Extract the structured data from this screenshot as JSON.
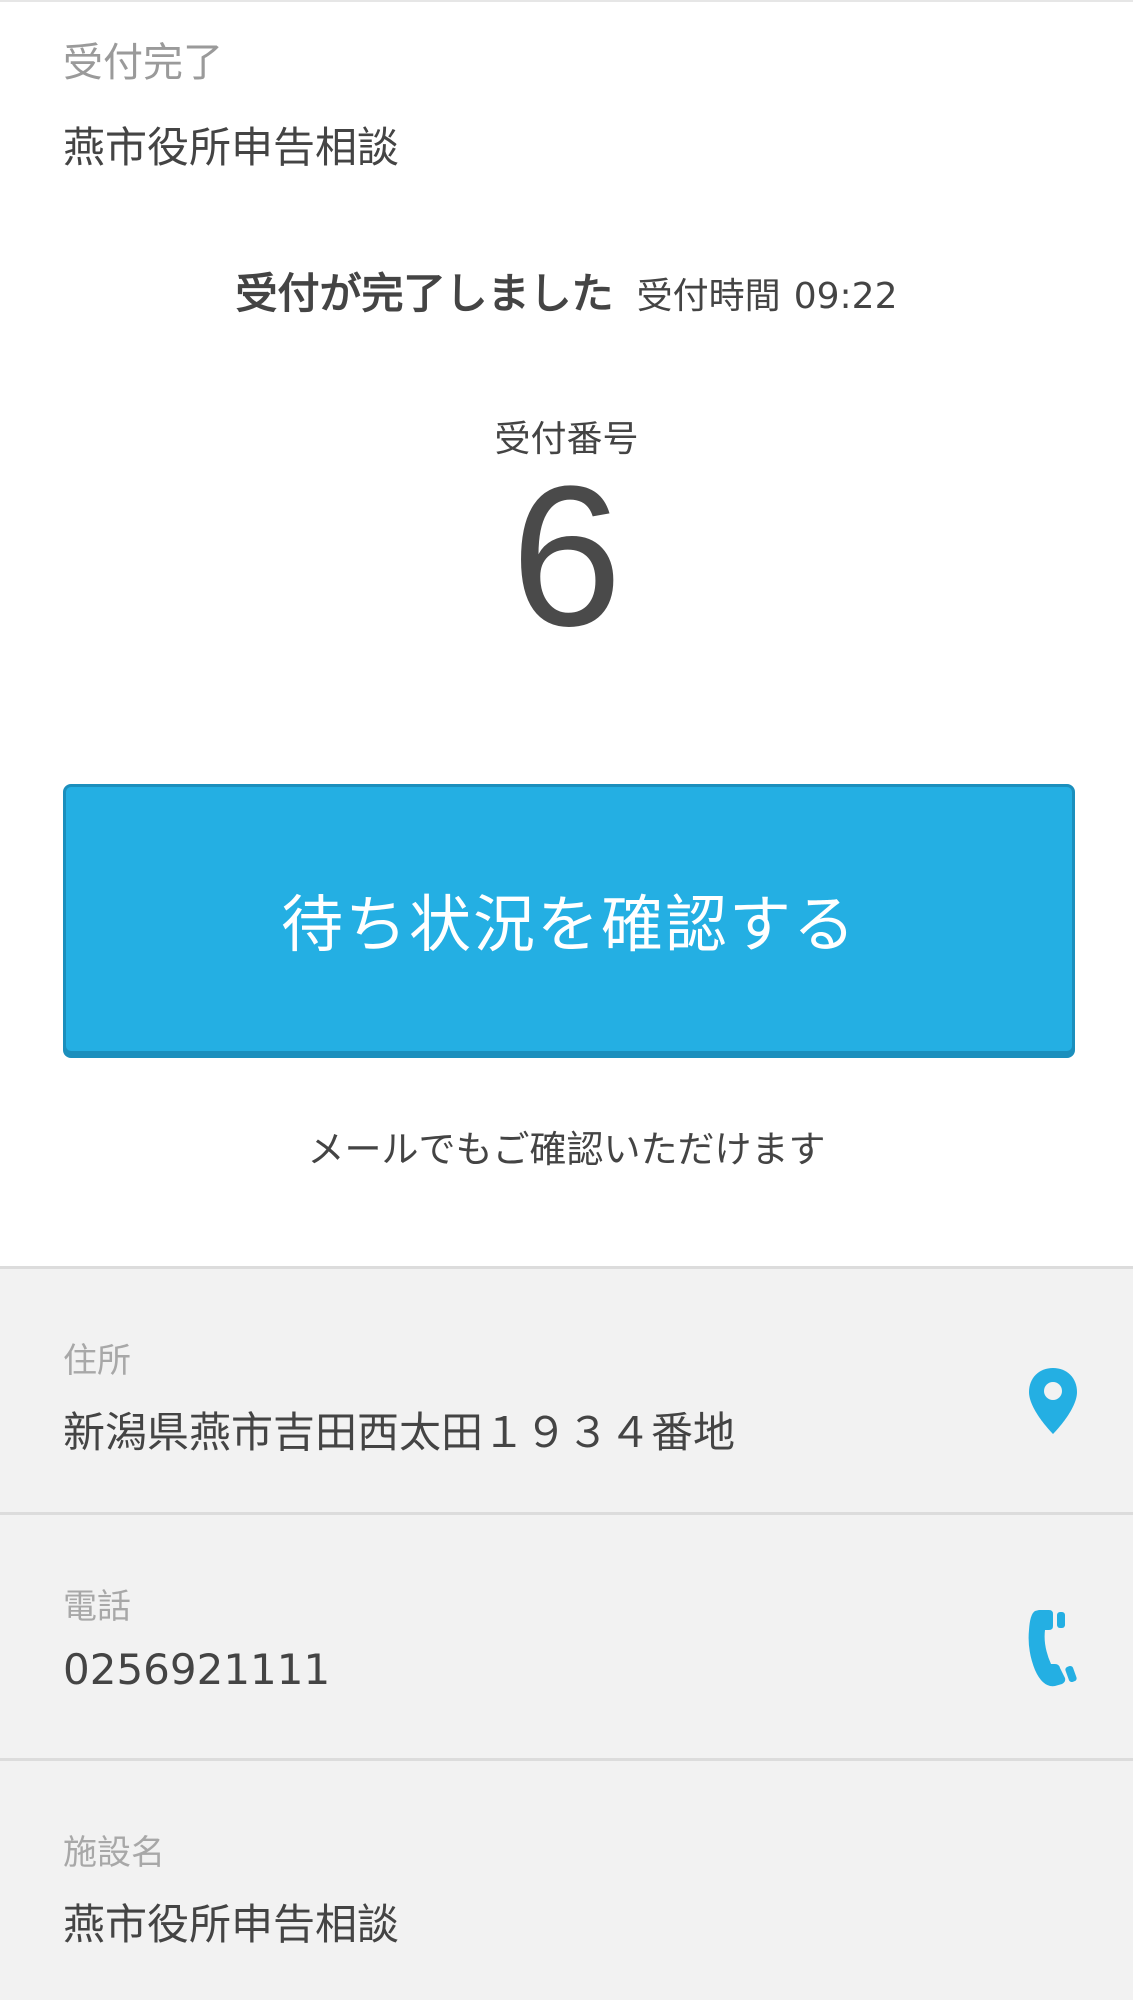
{
  "header": {
    "status_label": "受付完了",
    "facility_title": "燕市役所申告相談"
  },
  "confirmation": {
    "message": "受付が完了しました",
    "time_label": "受付時間",
    "time_value": "09:22",
    "number_label": "受付番号",
    "number_value": "6"
  },
  "actions": {
    "check_status_label": "待ち状況を確認する",
    "mail_note": "メールでもご確認いただけます"
  },
  "info": {
    "address_label": "住所",
    "address_value": "新潟県燕市吉田西太田１９３４番地",
    "address_icon": "map-pin-icon",
    "phone_label": "電話",
    "phone_value": "0256921111",
    "phone_icon": "phone-icon",
    "facility_label": "施設名",
    "facility_value": "燕市役所申告相談"
  },
  "colors": {
    "accent": "#24afe3",
    "icon": "#24afe3",
    "info_background": "#f2f2f2"
  }
}
